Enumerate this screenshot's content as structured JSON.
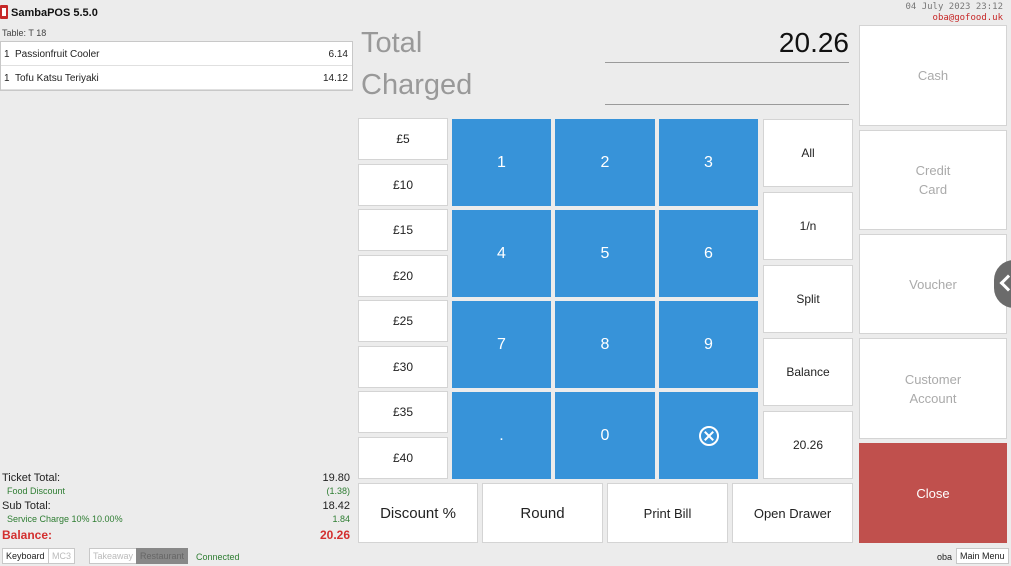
{
  "app": {
    "title": "SambaPOS 5.5.0",
    "datetime": "04 July 2023 23:12",
    "user_email": "oba@gofood.uk"
  },
  "ticket": {
    "table_label": "Table: T 18",
    "items": [
      {
        "qty": "1",
        "name": "Passionfruit Cooler",
        "price": "6.14"
      },
      {
        "qty": "1",
        "name": "Tofu Katsu Teriyaki",
        "price": "14.12"
      }
    ],
    "totals": {
      "ticket_total_label": "Ticket Total:",
      "ticket_total_value": "19.80",
      "discount_label": "Food Discount",
      "discount_value": "(1.38)",
      "subtotal_label": "Sub Total:",
      "subtotal_value": "18.42",
      "service_label": "Service Charge 10% 10.00%",
      "service_value": "1.84",
      "balance_label": "Balance:",
      "balance_value": "20.26"
    }
  },
  "display": {
    "total_label": "Total",
    "total_value": "20.26",
    "charged_label": "Charged",
    "charged_value": ""
  },
  "quick_amounts": [
    "£5",
    "£10",
    "£15",
    "£20",
    "£25",
    "£30",
    "£35",
    "£40"
  ],
  "numpad": [
    "1",
    "2",
    "3",
    "4",
    "5",
    "6",
    "7",
    "8",
    "9",
    ".",
    "0"
  ],
  "numpad_clear_icon": "clear-circle-x-icon",
  "split_options": [
    "All",
    "1/n",
    "Split",
    "Balance",
    "20.26"
  ],
  "actions": [
    "Discount %",
    "Round",
    "Print Bill",
    "Open Drawer"
  ],
  "payment_methods": [
    "Cash",
    "Credit\nCard",
    "Voucher",
    "Customer\nAccount"
  ],
  "close_label": "Close",
  "status_bar": {
    "buttons": [
      "Keyboard",
      "MC3",
      "Takeaway",
      "Restaurant"
    ],
    "status": "Connected",
    "user": "oba",
    "main_menu": "Main Menu"
  },
  "colors": {
    "numpad": "#3793d9",
    "close": "#c0504d",
    "balance": "#d32f2f",
    "accent_green": "#2e7d32"
  }
}
